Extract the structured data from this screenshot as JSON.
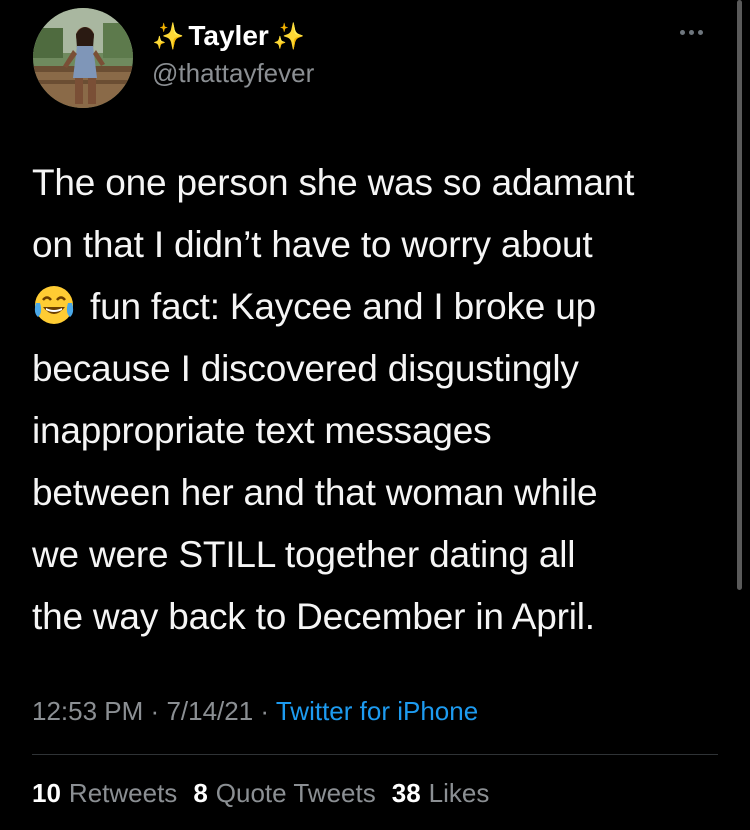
{
  "user": {
    "display_name": "Tayler",
    "name_decoration_icon": "sparkles-icon",
    "handle": "@thattayfever"
  },
  "more_icon": "ellipsis-icon",
  "tweet": {
    "lines": [
      "The one person she was so adamant",
      "on that I didn’t have to worry about",
      "fun fact: Kaycee and I broke up",
      "because I discovered disgustingly",
      "inappropriate text messages",
      "between her and that woman while",
      "we were STILL together dating all",
      "the way back to December in April."
    ],
    "emoji": "tears-of-joy-emoji"
  },
  "meta": {
    "time": "12:53 PM",
    "date": "7/14/21",
    "separator": "·",
    "source": "Twitter for iPhone"
  },
  "stats": {
    "retweets_count": "10",
    "retweets_label": "Retweets",
    "quotes_count": "8",
    "quotes_label": "Quote Tweets",
    "likes_count": "38",
    "likes_label": "Likes"
  },
  "colors": {
    "background": "#000000",
    "link": "#1d9bf0",
    "secondary_text": "#8b8f93",
    "sparkle": "#ffd33d"
  }
}
